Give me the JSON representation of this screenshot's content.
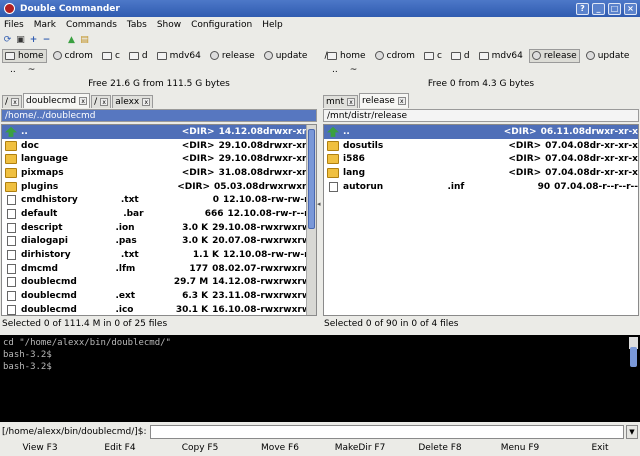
{
  "window": {
    "title": "Double Commander",
    "buttons": [
      "?",
      "_",
      "□",
      "×"
    ]
  },
  "menu": [
    "Files",
    "Mark",
    "Commands",
    "Tabs",
    "Show",
    "Configuration",
    "Help"
  ],
  "toolbar": [
    {
      "icon": "refresh-icon",
      "glyph": "⟳"
    },
    {
      "icon": "terminal-icon",
      "glyph": "▣"
    },
    {
      "icon": "plus-icon",
      "glyph": "+"
    },
    {
      "icon": "minus-icon",
      "glyph": "−"
    },
    {
      "icon": "up-arrow-icon",
      "glyph": "▲"
    },
    {
      "icon": "folder-icon",
      "glyph": "▤"
    }
  ],
  "left": {
    "drives": [
      {
        "label": "home",
        "type": "hdd",
        "active": true
      },
      {
        "label": "cdrom",
        "type": "cd",
        "active": false
      },
      {
        "label": "c",
        "type": "hdd",
        "active": false
      },
      {
        "label": "d",
        "type": "hdd",
        "active": false
      },
      {
        "label": "mdv64",
        "type": "hdd",
        "active": false
      },
      {
        "label": "release",
        "type": "cd",
        "active": false
      },
      {
        "label": "update",
        "type": "cd",
        "active": false
      },
      {
        "label": "/",
        "type": "none",
        "active": false
      }
    ],
    "path_buttons": [
      "..",
      "~"
    ],
    "free_space": "Free 21.6 G from 111.5 G bytes",
    "tabs": [
      {
        "label": "/",
        "active": false
      },
      {
        "label": "doublecmd",
        "active": true
      },
      {
        "label": "/",
        "active": false
      },
      {
        "label": "alexx",
        "active": false
      }
    ],
    "path": "/home/../doublecmd",
    "files": [
      {
        "name": "..",
        "ext": "",
        "size": "<DIR>",
        "date": "14.12.08",
        "attr": "drwxr-xr-x",
        "type": "up",
        "selected": true
      },
      {
        "name": "doc",
        "ext": "",
        "size": "<DIR>",
        "date": "29.10.08",
        "attr": "drwxr-xr-x",
        "type": "folder"
      },
      {
        "name": "language",
        "ext": "",
        "size": "<DIR>",
        "date": "29.10.08",
        "attr": "drwxr-xr-x",
        "type": "folder"
      },
      {
        "name": "pixmaps",
        "ext": "",
        "size": "<DIR>",
        "date": "31.08.08",
        "attr": "drwxr-xr-x",
        "type": "folder"
      },
      {
        "name": "plugins",
        "ext": "",
        "size": "<DIR>",
        "date": "05.03.08",
        "attr": "drwxrwxr-x",
        "type": "folder"
      },
      {
        "name": "cmdhistory",
        "ext": ".txt",
        "size": "0",
        "date": "12.10.08",
        "attr": "-rw-rw-r--",
        "type": "file"
      },
      {
        "name": "default",
        "ext": ".bar",
        "size": "666",
        "date": "12.10.08",
        "attr": "-rw-r--r--",
        "type": "file"
      },
      {
        "name": "descript",
        "ext": ".ion",
        "size": "3.0 K",
        "date": "29.10.08",
        "attr": "-rwxrwxrwx",
        "type": "file"
      },
      {
        "name": "dialogapi",
        "ext": ".pas",
        "size": "3.0 K",
        "date": "20.07.08",
        "attr": "-rwxrwxrwx",
        "type": "file"
      },
      {
        "name": "dirhistory",
        "ext": ".txt",
        "size": "1.1 K",
        "date": "12.10.08",
        "attr": "-rw-rw-r--",
        "type": "file"
      },
      {
        "name": "dmcmd",
        "ext": ".lfm",
        "size": "177",
        "date": "08.02.07",
        "attr": "-rwxrwxrwx",
        "type": "file"
      },
      {
        "name": "doublecmd",
        "ext": "",
        "size": "29.7 M",
        "date": "14.12.08",
        "attr": "-rwxrwxrwx",
        "type": "file"
      },
      {
        "name": "doublecmd",
        "ext": ".ext",
        "size": "6.3 K",
        "date": "23.11.08",
        "attr": "-rwxrwxrwx",
        "type": "file"
      },
      {
        "name": "doublecmd",
        "ext": ".ico",
        "size": "30.1 K",
        "date": "16.10.08",
        "attr": "-rwxrwxrwx",
        "type": "file"
      }
    ],
    "status": "Selected 0 of 111.4 M in 0 of 25 files"
  },
  "right": {
    "drives": [
      {
        "label": "home",
        "type": "hdd",
        "active": false
      },
      {
        "label": "cdrom",
        "type": "cd",
        "active": false
      },
      {
        "label": "c",
        "type": "hdd",
        "active": false
      },
      {
        "label": "d",
        "type": "hdd",
        "active": false
      },
      {
        "label": "mdv64",
        "type": "hdd",
        "active": false
      },
      {
        "label": "release",
        "type": "cd",
        "active": true
      },
      {
        "label": "update",
        "type": "cd",
        "active": false
      },
      {
        "label": "/",
        "type": "none",
        "active": false
      }
    ],
    "path_buttons": [
      "..",
      "~"
    ],
    "free_space": "Free 0 from 4.3 G bytes",
    "tabs": [
      {
        "label": "mnt",
        "active": false
      },
      {
        "label": "release",
        "active": true
      }
    ],
    "path": "/mnt/distr/release",
    "files": [
      {
        "name": "..",
        "ext": "",
        "size": "<DIR>",
        "date": "06.11.08",
        "attr": "drwxr-xr-x",
        "type": "up",
        "selected": true
      },
      {
        "name": "dosutils",
        "ext": "",
        "size": "<DIR>",
        "date": "07.04.08",
        "attr": "dr-xr-xr-x",
        "type": "folder"
      },
      {
        "name": "i586",
        "ext": "",
        "size": "<DIR>",
        "date": "07.04.08",
        "attr": "dr-xr-xr-x",
        "type": "folder"
      },
      {
        "name": "lang",
        "ext": "",
        "size": "<DIR>",
        "date": "07.04.08",
        "attr": "dr-xr-xr-x",
        "type": "folder"
      },
      {
        "name": "autorun",
        "ext": ".inf",
        "size": "90",
        "date": "07.04.08",
        "attr": "-r--r--r--",
        "type": "file"
      }
    ],
    "status": "Selected 0 of 90 in 0 of 4 files"
  },
  "terminal": {
    "lines": [
      "cd \"/home/alexx/bin/doublecmd/\"",
      "bash-3.2$",
      "bash-3.2$"
    ]
  },
  "cmdline": {
    "prompt": "[/home/alexx/bin/doublecmd/]$:",
    "value": ""
  },
  "fkeys": [
    "View F3",
    "Edit F4",
    "Copy F5",
    "Move F6",
    "MakeDir F7",
    "Delete F8",
    "Menu F9",
    "Exit"
  ]
}
